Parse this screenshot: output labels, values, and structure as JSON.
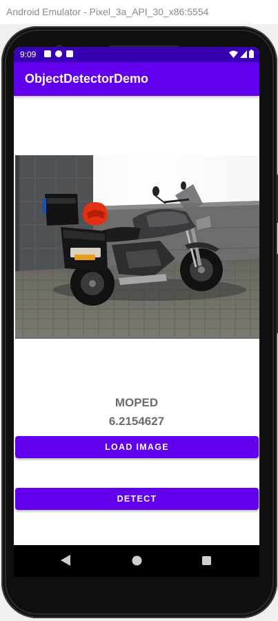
{
  "window": {
    "title": "Android Emulator - Pixel_3a_API_30_x86:5554"
  },
  "status_bar": {
    "time": "9:09",
    "left_icons": [
      "a-icon",
      "play-protect-icon",
      "sd-card-icon"
    ],
    "right_icons": [
      "wifi-icon",
      "signal-icon",
      "battery-icon"
    ],
    "color": "#3700b3"
  },
  "app_bar": {
    "title": "ObjectDetectorDemo",
    "color": "#6200ee"
  },
  "result": {
    "label": "MOPED",
    "score": "6.2154627"
  },
  "buttons": {
    "load_image": "LOAD IMAGE",
    "detect": "DETECT",
    "color": "#6200ee"
  },
  "nav_bar": {
    "icons": [
      "back-icon",
      "home-icon",
      "recents-icon"
    ]
  }
}
